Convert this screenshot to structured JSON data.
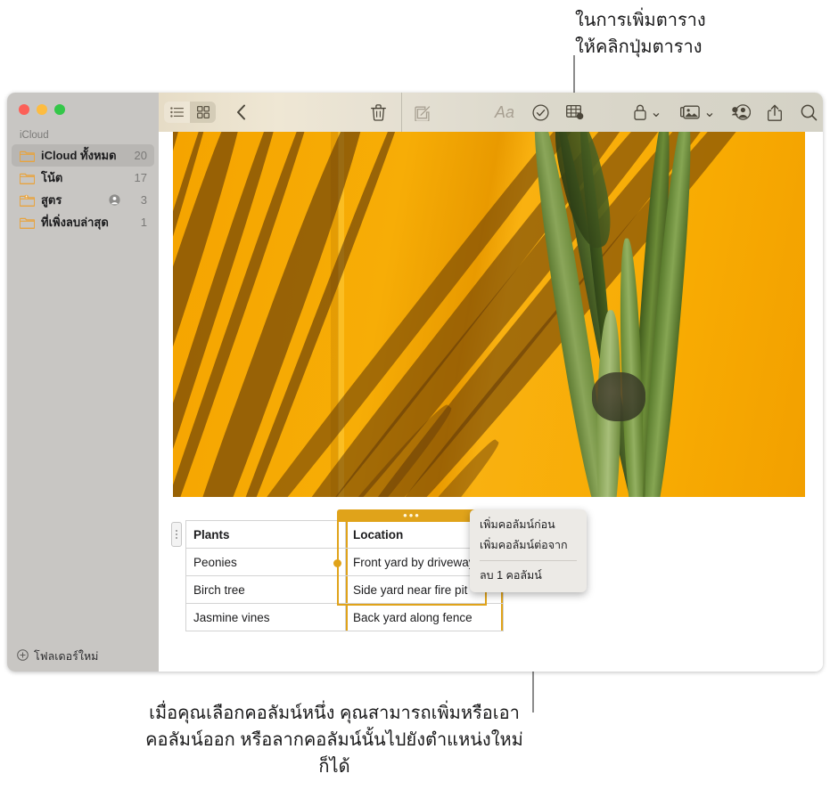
{
  "callouts": {
    "top": "ในการเพิ่มตาราง\nให้คลิกปุ่มตาราง",
    "bottom": "เมื่อคุณเลือกคอลัมน์หนึ่ง คุณสามารถเพิ่มหรือเอาคอลัมน์ออก หรือลากคอลัมน์นั้นไปยังตำแหน่งใหม่ก็ได้"
  },
  "window": {
    "traffic_lights": {
      "close": "close-button",
      "minimize": "minimize-button",
      "zoom": "zoom-button"
    }
  },
  "sidebar": {
    "section_label": "iCloud",
    "items": [
      {
        "label": "iCloud ทั้งหมด",
        "count": "20",
        "icon": "folder-icon",
        "selected": true,
        "shared": false
      },
      {
        "label": "โน้ต",
        "count": "17",
        "icon": "folder-icon",
        "selected": false,
        "shared": false
      },
      {
        "label": "สูตร",
        "count": "3",
        "icon": "folder-shared-icon",
        "selected": false,
        "shared": true
      },
      {
        "label": "ที่เพิ่งลบล่าสุด",
        "count": "1",
        "icon": "folder-icon",
        "selected": false,
        "shared": false
      }
    ],
    "new_folder_label": "โฟลเดอร์ใหม่",
    "new_folder_icon": "plus-circle-icon"
  },
  "toolbar": {
    "left_group": [
      {
        "name": "list-view-button",
        "icon": "list-view-icon",
        "active": false
      },
      {
        "name": "gallery-view-button",
        "icon": "grid-view-icon",
        "active": true
      }
    ],
    "back_button": {
      "name": "back-button",
      "icon": "chevron-left-icon"
    },
    "delete_button": {
      "name": "delete-note-button",
      "icon": "trash-icon"
    },
    "compose_button": {
      "name": "new-note-button",
      "icon": "compose-icon"
    },
    "format_button": {
      "name": "format-button",
      "icon": "aa-format-icon",
      "label": "Aa"
    },
    "checklist_button": {
      "name": "checklist-button",
      "icon": "checkmark-circle-icon"
    },
    "table_button": {
      "name": "table-button",
      "icon": "table-icon"
    },
    "lock_button": {
      "name": "lock-button",
      "icon": "lock-icon",
      "has_chevron": true
    },
    "media_button": {
      "name": "media-button",
      "icon": "photo-icon",
      "has_chevron": true
    },
    "share_collab_button": {
      "name": "collaborate-button",
      "icon": "person-badge-icon"
    },
    "share_button": {
      "name": "share-button",
      "icon": "share-up-arrow-icon"
    },
    "search_button": {
      "name": "search-button",
      "icon": "magnifier-icon"
    }
  },
  "note": {
    "photo_alt": "orange-wall-with-palm-shadows-photo",
    "table": {
      "columns": [
        "Plants",
        "Location"
      ],
      "selected_column_index": 1,
      "column_handle_glyph": "•••",
      "rows": [
        [
          "Peonies",
          "Front yard by driveway"
        ],
        [
          "Birch tree",
          "Side yard near fire pit"
        ],
        [
          "Jasmine vines",
          "Back yard along fence"
        ]
      ]
    }
  },
  "context_menu": {
    "items": [
      {
        "label": "เพิ่มคอลัมน์ก่อน",
        "separator_after": false
      },
      {
        "label": "เพิ่มคอลัมน์ต่อจาก",
        "separator_after": true
      },
      {
        "label": "ลบ 1 คอลัมน์",
        "separator_after": false
      }
    ]
  },
  "colors": {
    "accent_gold": "#e0a31a",
    "sidebar_bg": "#c8c6c3",
    "folder_icon": "#e8a33d",
    "photo_orange": "#f6a800"
  }
}
